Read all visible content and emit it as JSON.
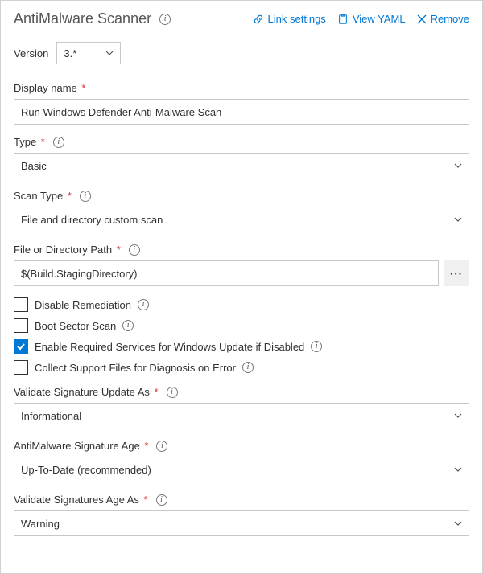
{
  "header": {
    "title": "AntiMalware Scanner",
    "links": {
      "link_settings": "Link settings",
      "view_yaml": "View YAML",
      "remove": "Remove"
    }
  },
  "version": {
    "label": "Version",
    "value": "3.*"
  },
  "fields": {
    "display_name": {
      "label": "Display name",
      "value": "Run Windows Defender Anti-Malware Scan"
    },
    "type": {
      "label": "Type",
      "value": "Basic"
    },
    "scan_type": {
      "label": "Scan Type",
      "value": "File and directory custom scan"
    },
    "path": {
      "label": "File or Directory Path",
      "value": "$(Build.StagingDirectory)"
    },
    "validate_sig_update": {
      "label": "Validate Signature Update As",
      "value": "Informational"
    },
    "sig_age": {
      "label": "AntiMalware Signature Age",
      "value": "Up-To-Date (recommended)"
    },
    "validate_sig_age": {
      "label": "Validate Signatures Age As",
      "value": "Warning"
    }
  },
  "checkboxes": {
    "disable_remediation": {
      "label": "Disable Remediation",
      "checked": false
    },
    "boot_sector": {
      "label": "Boot Sector Scan",
      "checked": false
    },
    "enable_services": {
      "label": "Enable Required Services for Windows Update if Disabled",
      "checked": true
    },
    "collect_support": {
      "label": "Collect Support Files for Diagnosis on Error",
      "checked": false
    }
  }
}
